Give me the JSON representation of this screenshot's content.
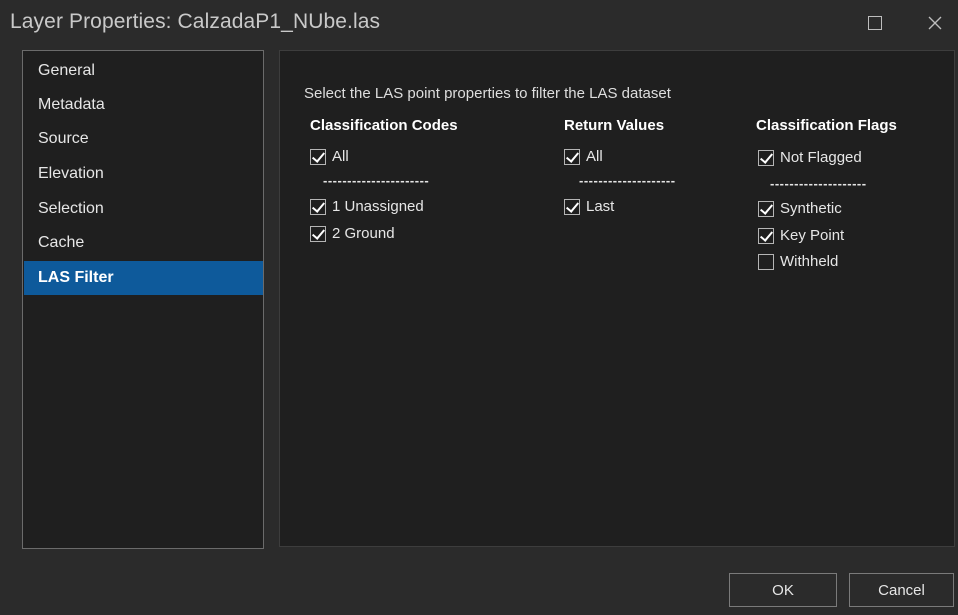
{
  "window": {
    "title": "Layer Properties: CalzadaP1_NUbe.las",
    "maximize_glyph": "",
    "close_glyph": "✕"
  },
  "sidebar": {
    "items": [
      {
        "label": "General"
      },
      {
        "label": "Metadata"
      },
      {
        "label": "Source"
      },
      {
        "label": "Elevation"
      },
      {
        "label": "Selection"
      },
      {
        "label": "Cache"
      },
      {
        "label": "LAS Filter",
        "active": true
      }
    ]
  },
  "main": {
    "instruction": "Select the LAS point properties to filter the LAS dataset",
    "columns": {
      "classification_codes": {
        "header": "Classification Codes",
        "all": {
          "label": "All",
          "checked": true
        },
        "separator": "----------------------",
        "items": [
          {
            "label": "1 Unassigned",
            "checked": true
          },
          {
            "label": "2 Ground",
            "checked": true
          }
        ]
      },
      "return_values": {
        "header": "Return Values",
        "all": {
          "label": "All",
          "checked": true
        },
        "separator": "--------------------",
        "items": [
          {
            "label": "Last",
            "checked": true
          }
        ]
      },
      "classification_flags": {
        "header": "Classification Flags",
        "all": {
          "label": "Not Flagged",
          "checked": true
        },
        "separator": "--------------------",
        "items": [
          {
            "label": "Synthetic",
            "checked": true
          },
          {
            "label": "Key Point",
            "checked": true
          },
          {
            "label": "Withheld",
            "checked": false
          }
        ]
      }
    }
  },
  "footer": {
    "ok_label": "OK",
    "cancel_label": "Cancel"
  }
}
